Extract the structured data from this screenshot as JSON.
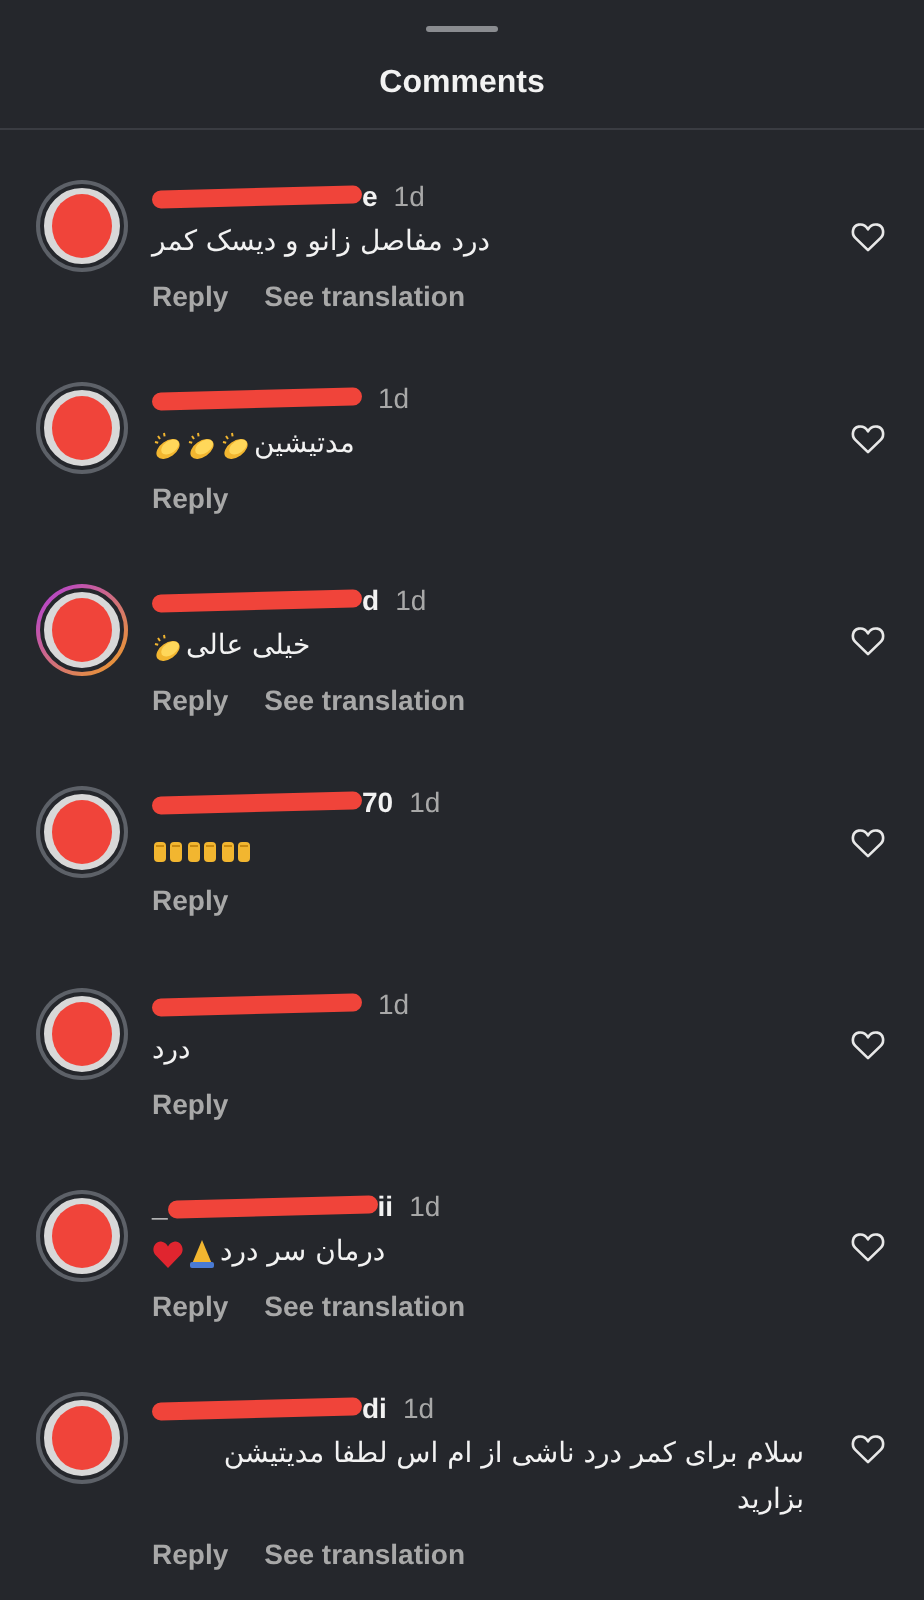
{
  "title": "Comments",
  "comments": [
    {
      "name_end": "e",
      "time": "1d",
      "text": "درد مفاصل زانو و دیسک کمر",
      "story_ring": false,
      "reply": "Reply",
      "translation": "See translation"
    },
    {
      "time": "1d",
      "text": "مدتیشین",
      "emojis": [
        {
          "kind": "clap"
        },
        {
          "kind": "clap"
        },
        {
          "kind": "clap"
        }
      ],
      "story_ring": false,
      "reply": "Reply"
    },
    {
      "name_end": "d",
      "time": "1d",
      "text": "خیلی عالی",
      "emojis": [
        {
          "kind": "clap"
        }
      ],
      "story_ring": true,
      "reply": "Reply",
      "translation": "See translation"
    },
    {
      "name_end": "70",
      "time": "1d",
      "emojis": [
        {
          "kind": "raised-hands"
        },
        {
          "kind": "raised-hands"
        },
        {
          "kind": "raised-hands"
        }
      ],
      "story_ring": false,
      "reply": "Reply"
    },
    {
      "time": "1d",
      "text": "درد",
      "story_ring": false,
      "reply": "Reply"
    },
    {
      "name_start": "_",
      "name_end": "ii",
      "time": "1d",
      "text": "درمان سر درد",
      "emojis": [
        {
          "kind": "pray"
        },
        {
          "kind": "heart"
        }
      ],
      "story_ring": false,
      "reply": "Reply",
      "translation": "See translation"
    },
    {
      "name_end": "di",
      "time": "1d",
      "text": "سلام برای کمر درد ناشی از ام اس لطفا مدیتیشن بزارید",
      "story_ring": false,
      "reply": "Reply",
      "translation": "See translation"
    }
  ]
}
